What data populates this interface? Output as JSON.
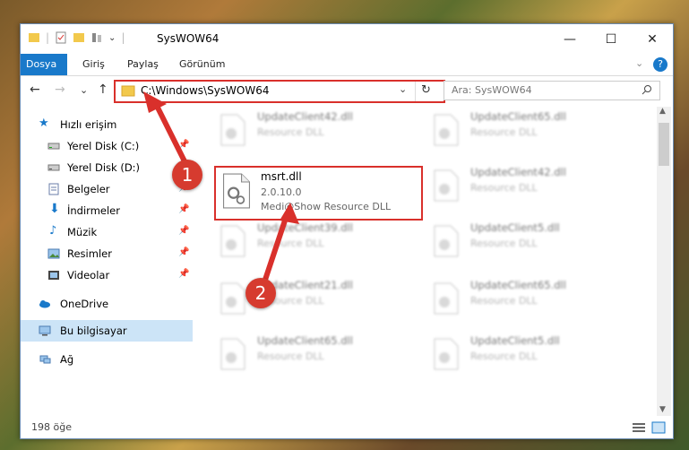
{
  "window": {
    "title": "SysWOW64",
    "controls": {
      "minimize": "—",
      "maximize": "☐",
      "close": "✕"
    }
  },
  "ribbon": {
    "tabs": [
      "Dosya",
      "Giriş",
      "Paylaş",
      "Görünüm"
    ],
    "help": "?"
  },
  "nav": {
    "back": "←",
    "forward": "→",
    "recent": "⌄",
    "up": "↑",
    "address": "C:\\Windows\\SysWOW64",
    "refresh": "↻",
    "search_placeholder": "Ara: SysWOW64"
  },
  "sidebar": {
    "items": [
      {
        "label": "Hızlı erişim",
        "icon": "star-icon",
        "pinned": false
      },
      {
        "label": "Yerel Disk (C:)",
        "icon": "drive-icon",
        "pinned": true
      },
      {
        "label": "Yerel Disk (D:)",
        "icon": "drive-icon",
        "pinned": true
      },
      {
        "label": "Belgeler",
        "icon": "document-icon",
        "pinned": true
      },
      {
        "label": "İndirmeler",
        "icon": "download-icon",
        "pinned": true
      },
      {
        "label": "Müzik",
        "icon": "music-icon",
        "pinned": true
      },
      {
        "label": "Resimler",
        "icon": "pictures-icon",
        "pinned": true
      },
      {
        "label": "Videolar",
        "icon": "video-icon",
        "pinned": true
      },
      {
        "label": "OneDrive",
        "icon": "cloud-icon",
        "pinned": false
      },
      {
        "label": "Bu bilgisayar",
        "icon": "computer-icon",
        "pinned": false
      },
      {
        "label": "Ağ",
        "icon": "network-icon",
        "pinned": false
      }
    ]
  },
  "files": [
    {
      "name": "UpdateClient42.dll",
      "type": "Resource DLL"
    },
    {
      "name": "UpdateClient65.dll",
      "type": "Resource DLL"
    },
    {
      "name": "msrt.dll",
      "version": "2.0.10.0",
      "type": "Medi@Show Resource DLL"
    },
    {
      "name": "UpdateClient42.dll",
      "type": "Resource DLL"
    },
    {
      "name": "UpdateClient39.dll",
      "type": "Resource DLL"
    },
    {
      "name": "UpdateClient5.dll",
      "type": "Resource DLL"
    },
    {
      "name": "UpdateClient21.dll",
      "type": "Resource DLL"
    },
    {
      "name": "UpdateClient65.dll",
      "type": "Resource DLL"
    },
    {
      "name": "UpdateClient65.dll",
      "type": "Resource DLL"
    },
    {
      "name": "UpdateClient5.dll",
      "type": "Resource DLL"
    }
  ],
  "status": {
    "count": "198 öğe"
  },
  "annotations": {
    "step1": "1",
    "step2": "2"
  },
  "colors": {
    "accent": "#1979ca",
    "highlight": "#d9302b",
    "selected": "#cce4f7"
  }
}
